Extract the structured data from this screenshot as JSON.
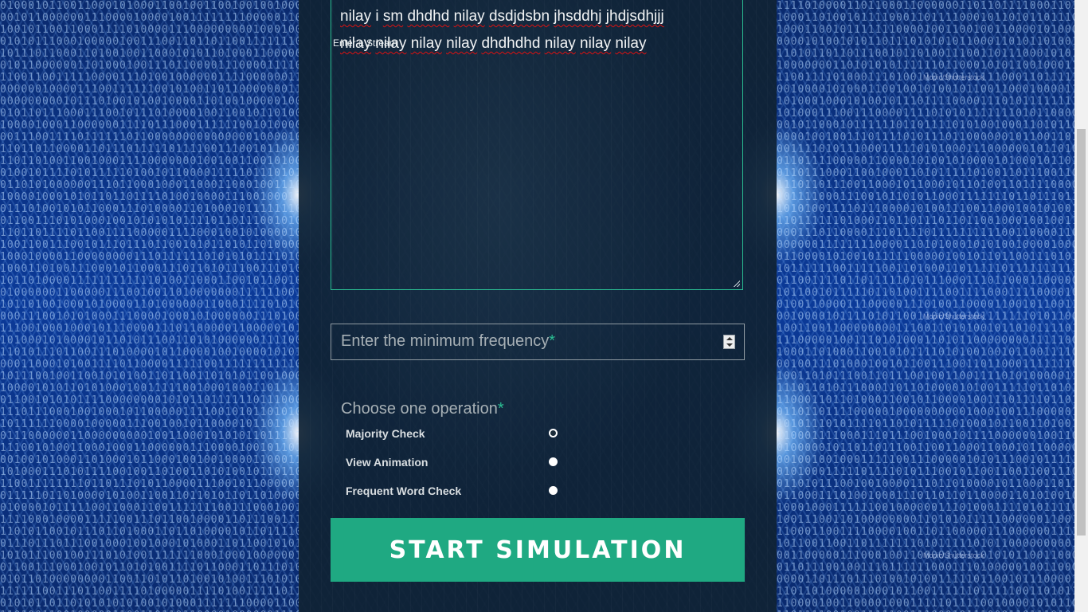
{
  "form": {
    "message_text_line1": [
      {
        "text": "nilay",
        "sq": true
      },
      {
        "text": " i "
      },
      {
        "text": "sm",
        "sq": true
      },
      {
        "text": " "
      },
      {
        "text": "dhdhd",
        "sq": true
      },
      {
        "text": " "
      },
      {
        "text": "nilay",
        "sq": true
      },
      {
        "text": " "
      },
      {
        "text": "dsdjdsbn",
        "sq": true
      },
      {
        "text": " "
      },
      {
        "text": "jhsddhj",
        "sq": true
      },
      {
        "text": " "
      },
      {
        "text": "jhdjsdhjjj",
        "sq": true
      }
    ],
    "message_text_line2": [
      {
        "text": "nilay",
        "sq": true
      },
      {
        "text": " "
      },
      {
        "text": "nilay",
        "sq": true
      },
      {
        "text": " "
      },
      {
        "text": "nilay",
        "sq": true
      },
      {
        "text": " "
      },
      {
        "text": "nilay",
        "sq": true
      },
      {
        "text": " "
      },
      {
        "text": "dhdhdhd",
        "sq": true
      },
      {
        "text": " "
      },
      {
        "text": "nilay",
        "sq": true
      },
      {
        "text": " "
      },
      {
        "text": "nilay",
        "sq": true
      },
      {
        "text": " "
      },
      {
        "text": "nilay",
        "sq": true
      }
    ],
    "message_label": "Enter a Stream",
    "frequency_placeholder": "Enter the minimum frequency",
    "required_mark": "*",
    "operation_title": "Choose one operation",
    "operations": [
      {
        "label": "Majority Check",
        "selected": true
      },
      {
        "label": "View Animation",
        "selected": false
      },
      {
        "label": "Frequent Word Check",
        "selected": false
      }
    ],
    "start_button": "START SIMULATION"
  },
  "background": {
    "watermark": "Mopic/Shutterstock"
  },
  "colors": {
    "accent": "#1fa982",
    "panel": "#10222f"
  }
}
